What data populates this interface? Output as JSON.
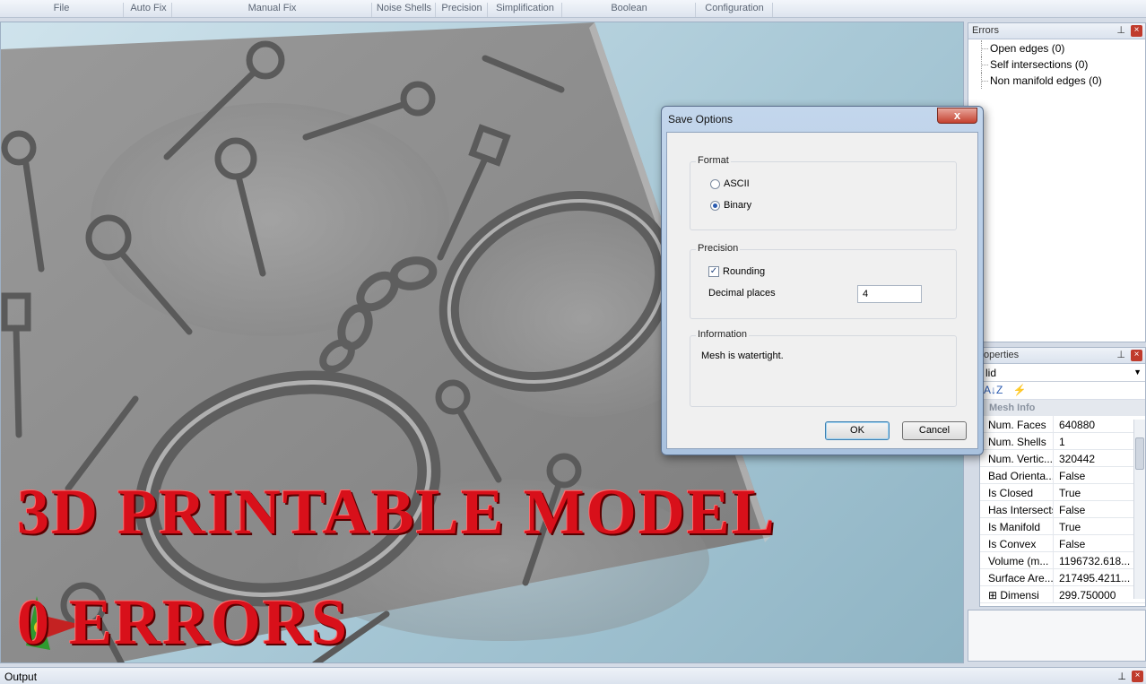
{
  "ribbon": {
    "groups": [
      "File",
      "Auto Fix",
      "Manual Fix",
      "Noise Shells",
      "Precision",
      "Simplification",
      "Boolean",
      "Configuration"
    ]
  },
  "viewport": {
    "overlay_line1": "3D PRINTABLE MODEL",
    "overlay_line2": "0 ERRORS"
  },
  "errors_panel": {
    "title": "Errors",
    "items": [
      "Open edges (0)",
      "Self intersections (0)",
      "Non manifold edges (0)"
    ]
  },
  "properties_panel": {
    "title": "Properties",
    "title_visible": "operties",
    "selector": "Solid",
    "selector_visible": "lid",
    "category": "Mesh Info",
    "rows": [
      {
        "key": "Num. Faces",
        "value": "640880"
      },
      {
        "key": "Num. Shells",
        "value": "1"
      },
      {
        "key": "Num. Vertic...",
        "value": "320442"
      },
      {
        "key": "Bad Orienta...",
        "value": "False"
      },
      {
        "key": "Is Closed",
        "value": "True"
      },
      {
        "key": "Has Intersects",
        "value": "False"
      },
      {
        "key": "Is Manifold",
        "value": "True"
      },
      {
        "key": "Is Convex",
        "value": "False"
      },
      {
        "key": "Volume (m...",
        "value": "1196732.618..."
      },
      {
        "key": "Surface Are...",
        "value": "217495.4211..."
      },
      {
        "key": "Dimensi",
        "value": "299.750000"
      }
    ]
  },
  "output_bar": {
    "title": "Output"
  },
  "dialog": {
    "title": "Save Options",
    "format": {
      "legend": "Format",
      "options": [
        {
          "label": "ASCII",
          "selected": false
        },
        {
          "label": "Binary",
          "selected": true
        }
      ]
    },
    "precision": {
      "legend": "Precision",
      "rounding_label": "Rounding",
      "rounding_checked": true,
      "decimal_label": "Decimal places",
      "decimal_value": "4"
    },
    "information": {
      "legend": "Information",
      "message": "Mesh is watertight."
    },
    "ok_label": "OK",
    "cancel_label": "Cancel"
  },
  "colors": {
    "overlay_text": "#d8101a",
    "viewport_bg": "#a8c8d6",
    "model_gray": "#8a8a8a"
  }
}
